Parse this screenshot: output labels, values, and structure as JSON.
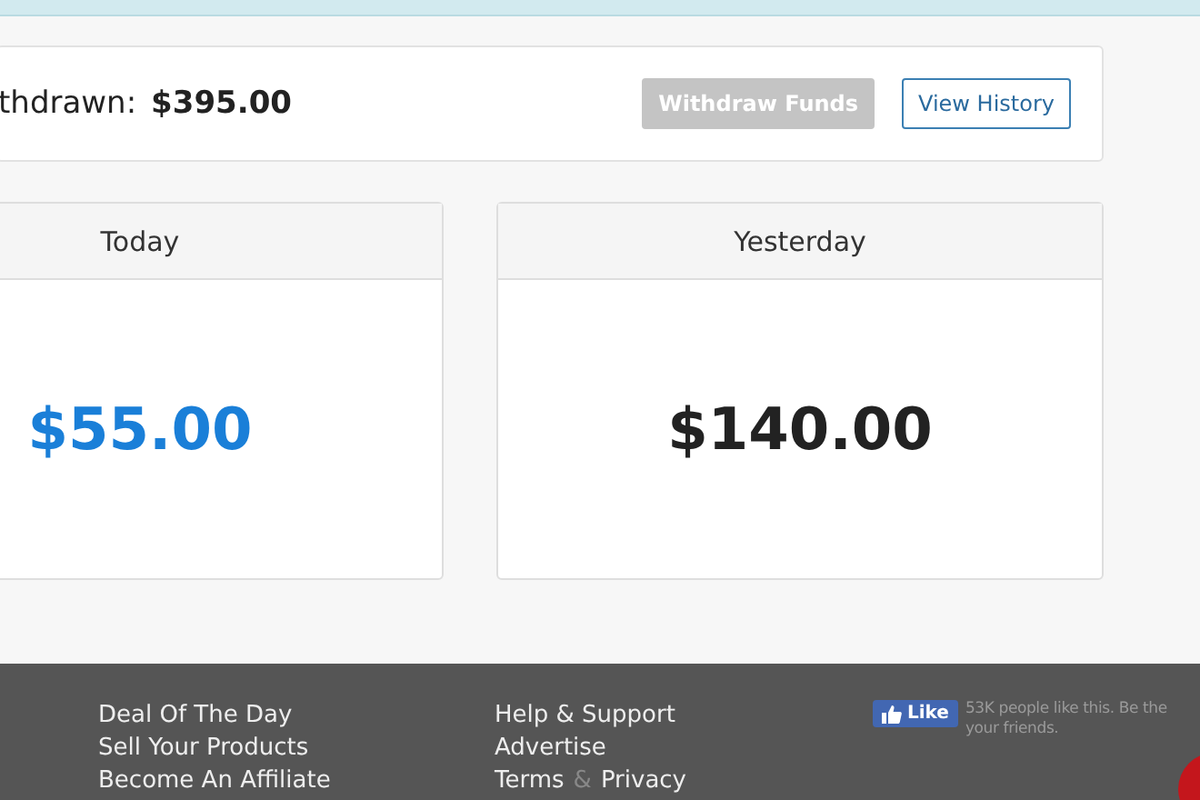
{
  "summary": {
    "label": "thdrawn:",
    "amount": "$395.00",
    "buttons": [
      {
        "label": "Withdraw Funds",
        "disabled": true
      },
      {
        "label": "View History",
        "disabled": false
      }
    ]
  },
  "stats": [
    {
      "title": "Today",
      "value": "$55.00",
      "highlight": true
    },
    {
      "title": "Yesterday",
      "value": "$140.00",
      "highlight": false
    }
  ],
  "footer": {
    "columns": [
      {
        "links": [
          {
            "parts": [
              "Deal Of The Day"
            ]
          },
          {
            "parts": [
              "Sell Your Products"
            ]
          },
          {
            "parts": [
              "Become An Affiliate"
            ]
          }
        ]
      },
      {
        "links": [
          {
            "parts": [
              "Help & Support"
            ]
          },
          {
            "parts": [
              "Advertise"
            ]
          },
          {
            "parts": [
              "Terms",
              "&",
              "Privacy"
            ]
          }
        ]
      }
    ],
    "like": {
      "button": "Like",
      "text": [
        "53K people like this. Be the",
        "your friends."
      ]
    }
  }
}
